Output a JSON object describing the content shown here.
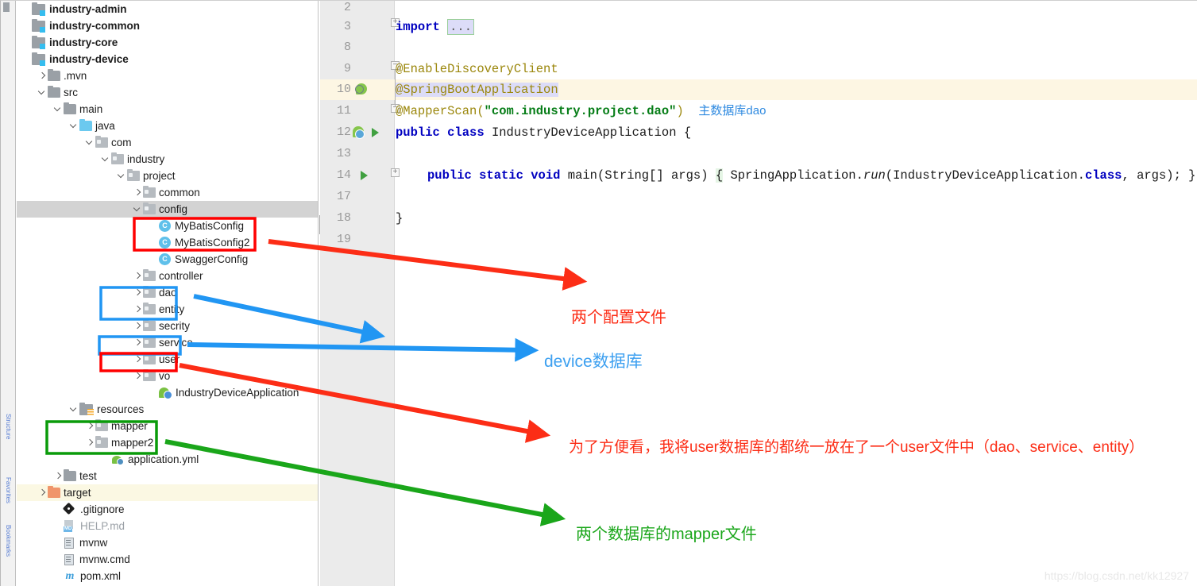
{
  "toolstrip": {
    "tabs": [
      "Structure",
      "Favorites",
      "Bookmarks"
    ]
  },
  "tree": {
    "nodes": [
      {
        "label": "industry-admin",
        "icon": "module-icon",
        "indent": 0,
        "chev": "none",
        "state": "normal",
        "bold": true
      },
      {
        "label": "industry-common",
        "icon": "module-icon",
        "indent": 0,
        "chev": "none",
        "state": "normal",
        "bold": true
      },
      {
        "label": "industry-core",
        "icon": "module-icon",
        "indent": 0,
        "chev": "none",
        "state": "normal",
        "bold": true
      },
      {
        "label": "industry-device",
        "icon": "module-icon",
        "indent": 0,
        "chev": "none",
        "state": "normal",
        "bold": true
      },
      {
        "label": ".mvn",
        "icon": "folder-icon",
        "indent": 1,
        "chev": "right",
        "state": "normal",
        "bold": false
      },
      {
        "label": "src",
        "icon": "folder-icon",
        "indent": 1,
        "chev": "down",
        "state": "normal",
        "bold": false
      },
      {
        "label": "main",
        "icon": "folder-icon",
        "indent": 2,
        "chev": "down",
        "state": "normal",
        "bold": false
      },
      {
        "label": "java",
        "icon": "source-folder-icon",
        "indent": 3,
        "chev": "down",
        "state": "normal",
        "bold": false
      },
      {
        "label": "com",
        "icon": "package-icon",
        "indent": 4,
        "chev": "down",
        "state": "normal",
        "bold": false
      },
      {
        "label": "industry",
        "icon": "package-icon",
        "indent": 5,
        "chev": "down",
        "state": "normal",
        "bold": false
      },
      {
        "label": "project",
        "icon": "package-icon",
        "indent": 6,
        "chev": "down",
        "state": "normal",
        "bold": false
      },
      {
        "label": "common",
        "icon": "package-icon",
        "indent": 7,
        "chev": "right",
        "state": "normal",
        "bold": false
      },
      {
        "label": "config",
        "icon": "package-icon",
        "indent": 7,
        "chev": "down",
        "state": "selected",
        "bold": false
      },
      {
        "label": "MyBatisConfig",
        "icon": "java-class-icon",
        "indent": 8,
        "chev": "none",
        "state": "normal",
        "bold": false
      },
      {
        "label": "MyBatisConfig2",
        "icon": "java-class-icon",
        "indent": 8,
        "chev": "none",
        "state": "normal",
        "bold": false
      },
      {
        "label": "SwaggerConfig",
        "icon": "java-class-icon",
        "indent": 8,
        "chev": "none",
        "state": "normal",
        "bold": false
      },
      {
        "label": "controller",
        "icon": "package-icon",
        "indent": 7,
        "chev": "right",
        "state": "normal",
        "bold": false
      },
      {
        "label": "dao",
        "icon": "package-icon",
        "indent": 7,
        "chev": "right",
        "state": "normal",
        "bold": false
      },
      {
        "label": "entity",
        "icon": "package-icon",
        "indent": 7,
        "chev": "right",
        "state": "normal",
        "bold": false
      },
      {
        "label": "secrity",
        "icon": "package-icon",
        "indent": 7,
        "chev": "right",
        "state": "normal",
        "bold": false
      },
      {
        "label": "service",
        "icon": "package-icon",
        "indent": 7,
        "chev": "right",
        "state": "normal",
        "bold": false
      },
      {
        "label": "user",
        "icon": "package-icon",
        "indent": 7,
        "chev": "right",
        "state": "normal",
        "bold": false
      },
      {
        "label": "vo",
        "icon": "package-icon",
        "indent": 7,
        "chev": "right",
        "state": "normal",
        "bold": false
      },
      {
        "label": "IndustryDeviceApplication",
        "icon": "spring-boot-class-icon",
        "indent": 8,
        "chev": "none",
        "state": "normal",
        "bold": false
      },
      {
        "label": "resources",
        "icon": "resources-folder-icon",
        "indent": 3,
        "chev": "down",
        "state": "normal",
        "bold": false
      },
      {
        "label": "mapper",
        "icon": "package-icon",
        "indent": 4,
        "chev": "right",
        "state": "normal",
        "bold": false
      },
      {
        "label": "mapper2",
        "icon": "package-icon",
        "indent": 4,
        "chev": "right",
        "state": "normal",
        "bold": false
      },
      {
        "label": "application.yml",
        "icon": "yaml-file-icon",
        "indent": 5,
        "chev": "none",
        "state": "normal",
        "bold": false
      },
      {
        "label": "test",
        "icon": "folder-icon",
        "indent": 2,
        "chev": "right",
        "state": "normal",
        "bold": false
      },
      {
        "label": "target",
        "icon": "excluded-folder-icon",
        "indent": 1,
        "chev": "right",
        "state": "highlight",
        "bold": false
      },
      {
        "label": ".gitignore",
        "icon": "git-icon",
        "indent": 2,
        "chev": "none",
        "state": "normal",
        "bold": false
      },
      {
        "label": "HELP.md",
        "icon": "markdown-icon",
        "indent": 2,
        "chev": "none",
        "state": "dimmed",
        "bold": false
      },
      {
        "label": "mvnw",
        "icon": "file-icon",
        "indent": 2,
        "chev": "none",
        "state": "normal",
        "bold": false
      },
      {
        "label": "mvnw.cmd",
        "icon": "file-icon",
        "indent": 2,
        "chev": "none",
        "state": "normal",
        "bold": false
      },
      {
        "label": "pom.xml",
        "icon": "maven-icon",
        "indent": 2,
        "chev": "none",
        "state": "normal",
        "bold": false
      }
    ]
  },
  "editor": {
    "line_numbers": [
      "2",
      "3",
      "8",
      "9",
      "10",
      "11",
      "12",
      "13",
      "14",
      "17",
      "18",
      "19"
    ],
    "lines": {
      "l3_import": "import",
      "l3_ellipsis": "...",
      "l9": "@EnableDiscoveryClient",
      "l10": "@SpringBootApplication",
      "l11_ann": "@MapperScan(",
      "l11_str": "\"com.industry.project.dao\"",
      "l11_close": ")",
      "l11_note": "主数据库dao",
      "l12_kw1": "public",
      "l12_kw2": "class",
      "l12_name": "IndustryDeviceApplication",
      "l12_brace": "{",
      "l14_kw1": "public",
      "l14_kw2": "static",
      "l14_kw3": "void",
      "l14_sig": "main(String[] args)",
      "l14_open": "{",
      "l14_body1": "SpringApplication.",
      "l14_run": "run",
      "l14_body2": "(IndustryDeviceApplication.",
      "l14_class": "class",
      "l14_body3": ", args); }",
      "l18": "}"
    }
  },
  "annotations": [
    {
      "id": "two-config-files",
      "text": "两个配置文件",
      "color": "#fc2d16"
    },
    {
      "id": "device-database",
      "text": "device数据库",
      "color": "#3da0f0"
    },
    {
      "id": "user-database-note",
      "text": "为了方便看，我将user数据库的都统一放在了一个user文件中（dao、service、entity）",
      "color": "#fc2d16"
    },
    {
      "id": "mapper-files",
      "text": "两个数据库的mapper文件",
      "color": "#1aa61a"
    }
  ],
  "highlight_boxes": [
    {
      "id": "mybatis-config-box",
      "color": "#ff0000"
    },
    {
      "id": "dao-entity-box",
      "color": "#2196f3"
    },
    {
      "id": "service-box",
      "color": "#2196f3"
    },
    {
      "id": "user-box",
      "color": "#ff0000"
    },
    {
      "id": "mapper-box",
      "color": "#0a9b0a"
    }
  ],
  "watermark": "https://blog.csdn.net/kk12927"
}
